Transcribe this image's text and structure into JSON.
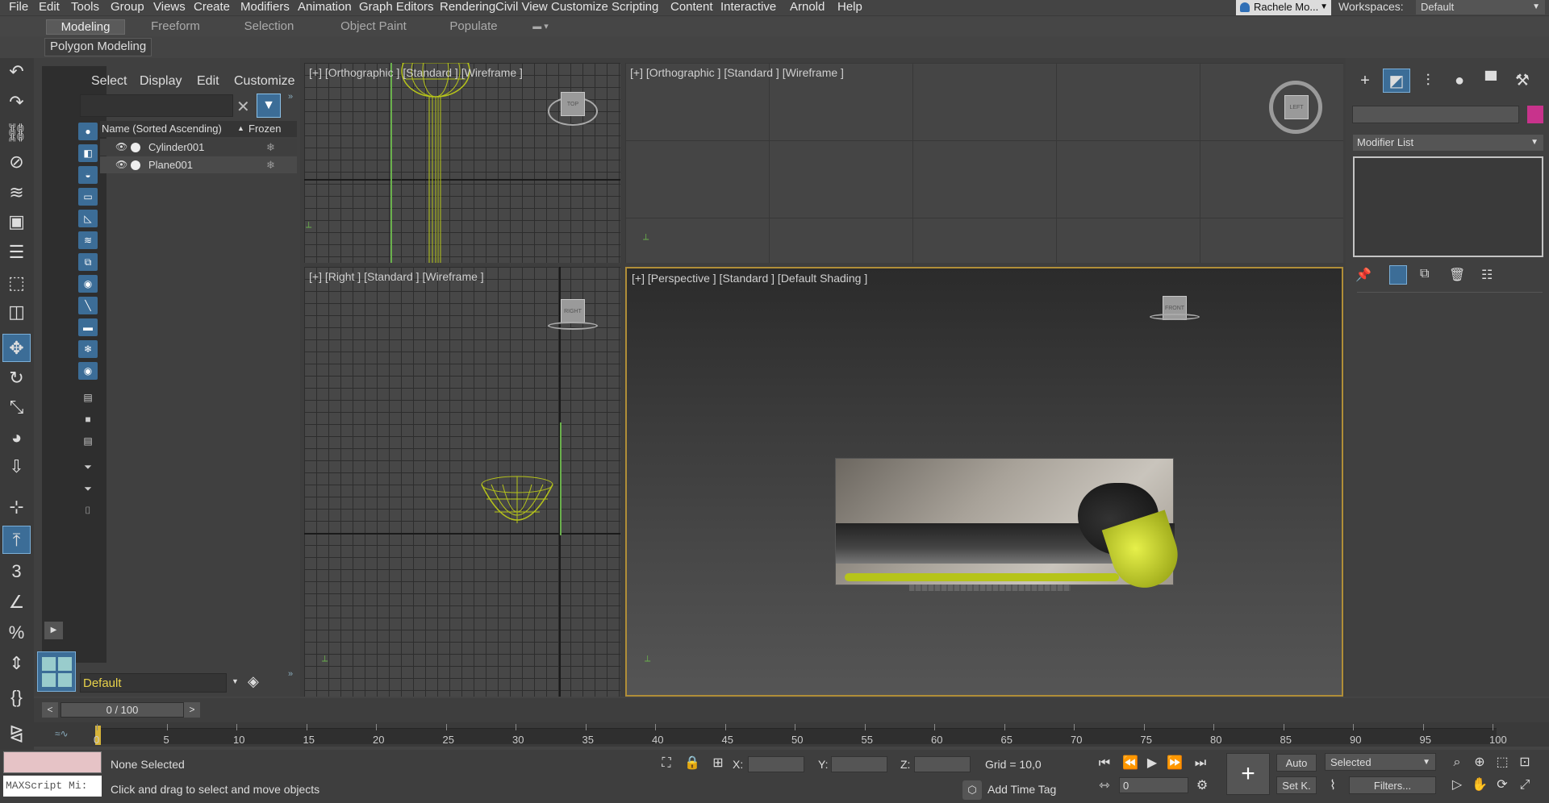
{
  "menubar": {
    "items": [
      "File",
      "Edit",
      "Tools",
      "Group",
      "Views",
      "Create",
      "Modifiers",
      "Animation",
      "Graph Editors",
      "Rendering",
      "Civil View",
      "Customize",
      "Scripting",
      "Content",
      "Interactive",
      "Arnold",
      "Help"
    ],
    "user": "Rachele Mo...",
    "workspaces_label": "Workspaces:",
    "workspace": "Default"
  },
  "ribbon": {
    "tabs": [
      "Modeling",
      "Freeform",
      "Selection",
      "Object Paint",
      "Populate"
    ],
    "active_tab": "Modeling",
    "sub_label": "Polygon Modeling"
  },
  "left_toolbar": {
    "icons": [
      "undo-icon",
      "redo-icon",
      "link-icon",
      "unlink-icon",
      "bind-space-warp-icon",
      "select-object-icon",
      "select-by-name-icon",
      "rectangle-selection-icon",
      "window-crossing-icon",
      "select-and-move-icon",
      "select-and-rotate-icon",
      "select-and-scale-icon",
      "select-and-place-icon",
      "selection-center-icon",
      "use-pivot-center-icon",
      "snaps-toggle-icon",
      "angle-snap-icon",
      "percent-snap-icon",
      "spinner-snap-icon",
      "edit-named-selections-icon",
      "mirror-icon"
    ],
    "selected": "select-and-move-icon"
  },
  "scene_explorer": {
    "menus": [
      "Select",
      "Display",
      "Edit",
      "Customize"
    ],
    "search_value": "",
    "columns": {
      "name": "Name (Sorted Ascending)",
      "frozen": "Frozen"
    },
    "rows": [
      {
        "name": "Cylinder001"
      },
      {
        "name": "Plane001"
      }
    ],
    "layer": "Default"
  },
  "viewports": {
    "top_left": "[+] [Orthographic ] [Standard ] [Wireframe ]",
    "top_right": "[+] [Orthographic ] [Standard ] [Wireframe ]",
    "bottom_left": "[+] [Right ] [Standard ] [Wireframe ]",
    "bottom_right": "[+] [Perspective ] [Standard ] [Default Shading ]",
    "active": "bottom_right",
    "object_color": "#b6c41a"
  },
  "command_panel": {
    "object_name": "",
    "object_color": "#c8338c",
    "modifier_list": "Modifier List"
  },
  "timeline": {
    "slider_text": "0 / 100",
    "frame_current": 0,
    "frame_end": 100,
    "ticks": [
      "0",
      "5",
      "10",
      "15",
      "20",
      "25",
      "30",
      "35",
      "40",
      "45",
      "50",
      "55",
      "60",
      "65",
      "70",
      "75",
      "80",
      "85",
      "90",
      "95",
      "100"
    ]
  },
  "status": {
    "selection": "None Selected",
    "prompt": "Click and drag to select and move objects",
    "maxscript": "MAXScript Mi:",
    "x_label": "X:",
    "y_label": "Y:",
    "z_label": "Z:",
    "x_value": "",
    "y_value": "",
    "z_value": "",
    "grid": "Grid = 10,0",
    "add_time_tag": "Add Time Tag",
    "auto_key": "Auto",
    "set_key": "Set K.",
    "key_filter": "Selected",
    "filters": "Filters...",
    "frame_field": "0"
  }
}
